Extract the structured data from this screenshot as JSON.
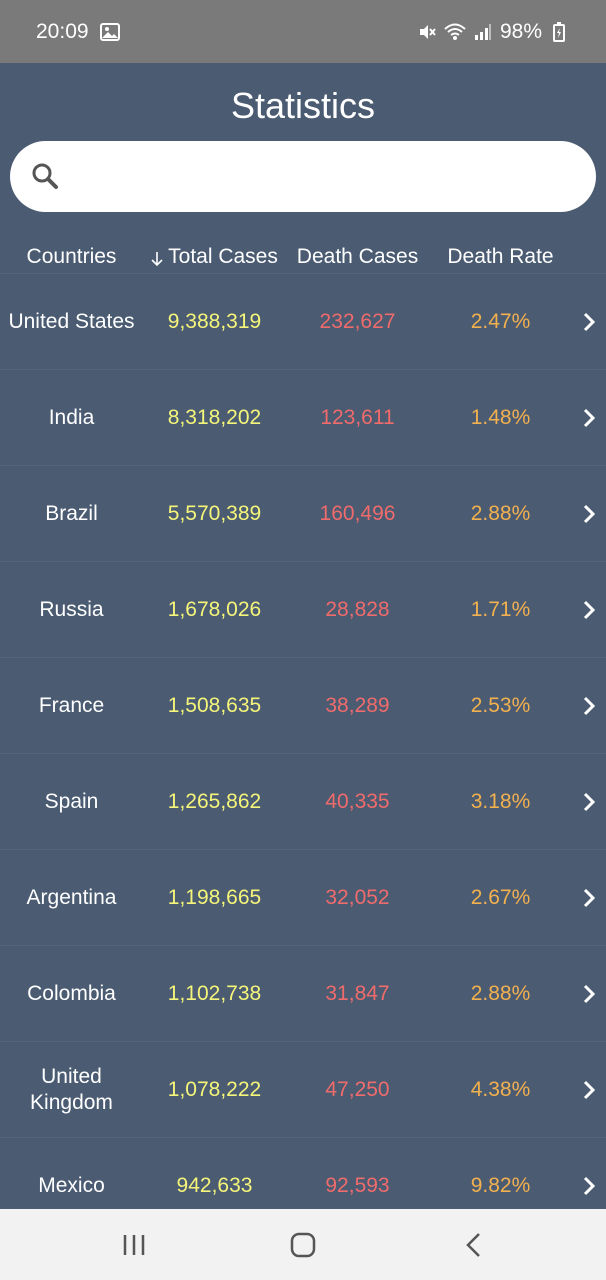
{
  "status": {
    "time": "20:09",
    "battery": "98%",
    "icons": [
      "gallery-icon",
      "mute-icon",
      "wifi-icon",
      "signal-icon",
      "battery-charging-icon"
    ]
  },
  "header": {
    "title": "Statistics"
  },
  "search": {
    "placeholder": "",
    "value": ""
  },
  "columns": {
    "country": "Countries",
    "total": "Total Cases",
    "death": "Death Cases",
    "rate": "Death Rate"
  },
  "rows": [
    {
      "country": "United States",
      "total": "9,388,319",
      "death": "232,627",
      "rate": "2.47%"
    },
    {
      "country": "India",
      "total": "8,318,202",
      "death": "123,611",
      "rate": "1.48%"
    },
    {
      "country": "Brazil",
      "total": "5,570,389",
      "death": "160,496",
      "rate": "2.88%"
    },
    {
      "country": "Russia",
      "total": "1,678,026",
      "death": "28,828",
      "rate": "1.71%"
    },
    {
      "country": "France",
      "total": "1,508,635",
      "death": "38,289",
      "rate": "2.53%"
    },
    {
      "country": "Spain",
      "total": "1,265,862",
      "death": "40,335",
      "rate": "3.18%"
    },
    {
      "country": "Argentina",
      "total": "1,198,665",
      "death": "32,052",
      "rate": "2.67%"
    },
    {
      "country": "Colombia",
      "total": "1,102,738",
      "death": "31,847",
      "rate": "2.88%"
    },
    {
      "country": "United Kingdom",
      "total": "1,078,222",
      "death": "47,250",
      "rate": "4.38%"
    },
    {
      "country": "Mexico",
      "total": "942,633",
      "death": "92,593",
      "rate": "9.82%"
    }
  ],
  "colors": {
    "background": "#4a5b72",
    "total_cases": "#f5f57a",
    "death_cases": "#f06b6b",
    "death_rate": "#f2b04e"
  }
}
